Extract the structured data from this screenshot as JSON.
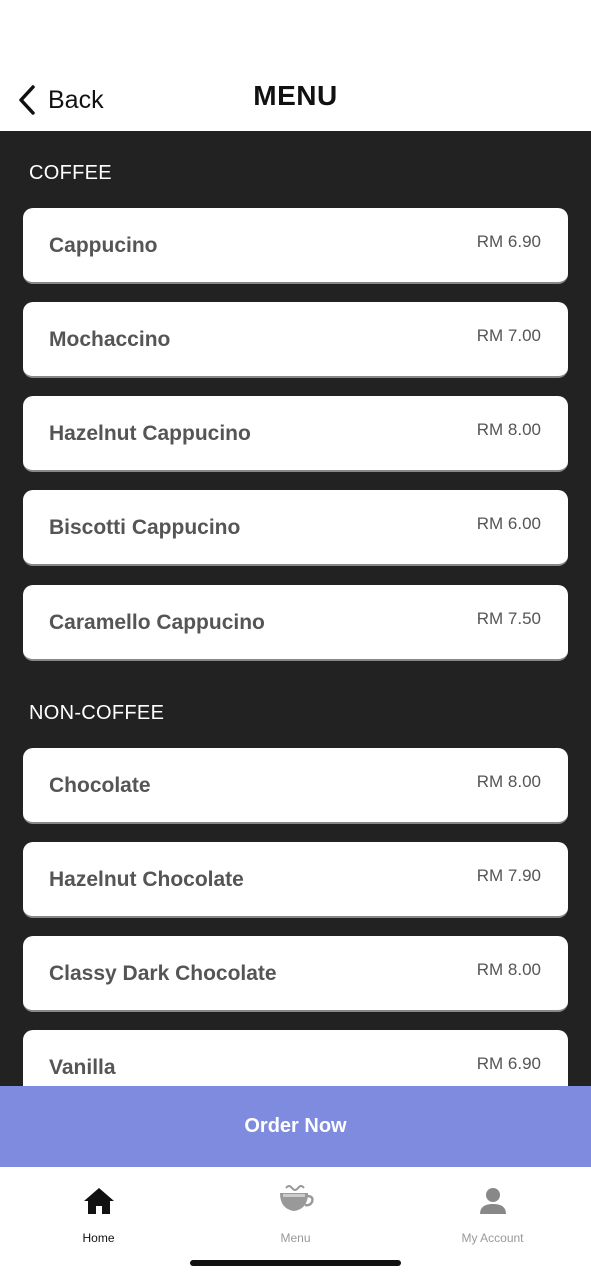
{
  "header": {
    "back_label": "Back",
    "title": "MENU"
  },
  "sections": [
    {
      "title": "COFFEE",
      "items": [
        {
          "name": "Cappucino",
          "price": "RM 6.90"
        },
        {
          "name": "Mochaccino",
          "price": "RM 7.00"
        },
        {
          "name": "Hazelnut Cappucino",
          "price": "RM 8.00"
        },
        {
          "name": "Biscotti Cappucino",
          "price": "RM 6.00"
        },
        {
          "name": "Caramello Cappucino",
          "price": "RM 7.50"
        }
      ]
    },
    {
      "title": "NON-COFFEE",
      "items": [
        {
          "name": "Chocolate",
          "price": "RM 8.00"
        },
        {
          "name": "Hazelnut Chocolate",
          "price": "RM 7.90"
        },
        {
          "name": "Classy Dark Chocolate",
          "price": "RM 8.00"
        },
        {
          "name": "Vanilla",
          "price": "RM 6.90"
        }
      ]
    }
  ],
  "order_button": "Order Now",
  "tabs": [
    {
      "label": "Home",
      "icon": "home-icon",
      "active": true
    },
    {
      "label": "Menu",
      "icon": "coffee-cup-icon",
      "active": false
    },
    {
      "label": "My Account",
      "icon": "user-icon",
      "active": false
    }
  ],
  "colors": {
    "accent": "#7e8bdf",
    "background": "#222222",
    "card": "#ffffff",
    "text": "#555555"
  }
}
